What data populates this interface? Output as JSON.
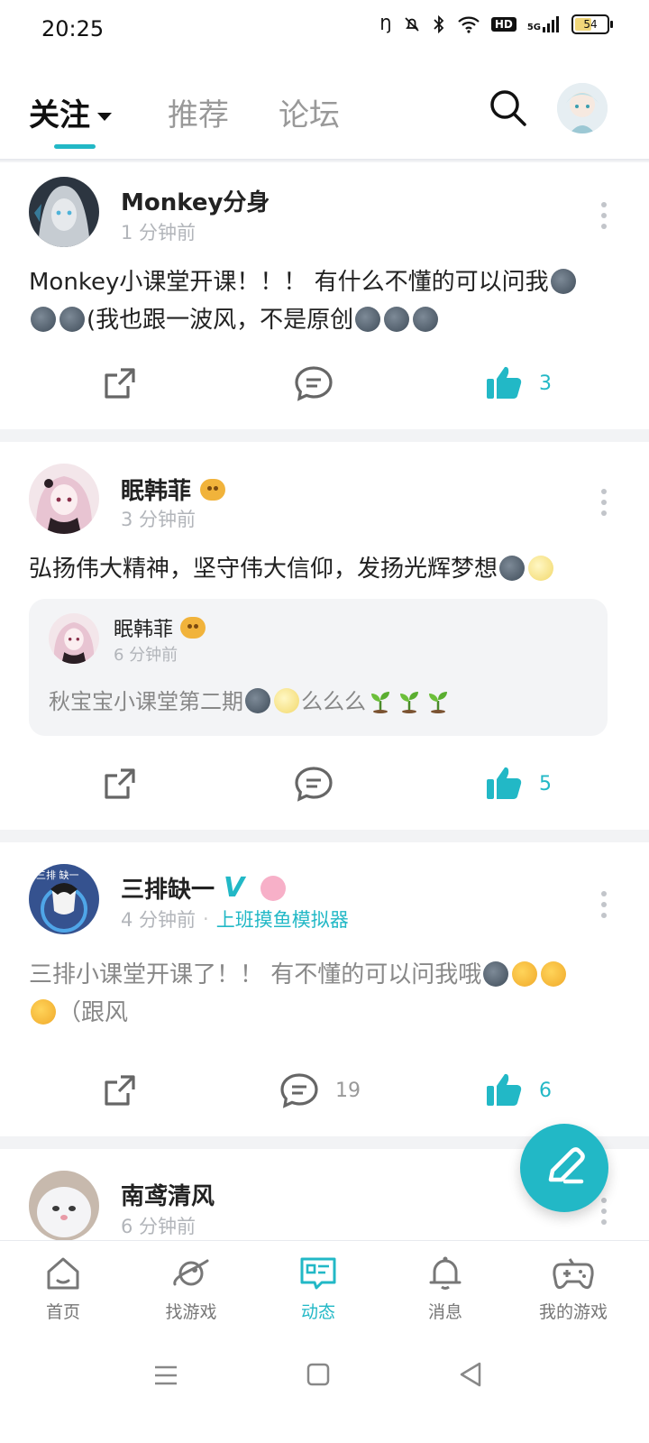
{
  "status_bar": {
    "time": "20:25",
    "network": "5G",
    "battery": "54",
    "battery_level": 0.54
  },
  "top_nav": {
    "tabs": [
      {
        "label": "关注"
      },
      {
        "label": "推荐"
      },
      {
        "label": "论坛"
      }
    ]
  },
  "posts": [
    {
      "user": "Monkey分身",
      "time": "1 分钟前",
      "text": "Monkey小课堂开课！！！ 有什么不懂的可以问我",
      "text2": "(我也跟一波风，不是原创",
      "likes": "3"
    },
    {
      "user": "眠韩菲",
      "time": "3 分钟前",
      "text": "弘扬伟大精神，坚守伟大信仰，发扬光辉梦想",
      "quote": {
        "user": "眠韩菲",
        "time": "6 分钟前",
        "text": "秋宝宝小课堂第二期",
        "text2": "么么么"
      },
      "likes": "5"
    },
    {
      "user": "三排缺一",
      "verified": "V",
      "time": "4 分钟前",
      "game": "上班摸鱼模拟器",
      "text": "三排小课堂开课了！！ 有不懂的可以问我哦",
      "text2": "（跟风",
      "comments": "19",
      "likes": "6"
    },
    {
      "user": "南鸢清风",
      "time": "6 分钟前"
    }
  ],
  "bottom_nav": [
    {
      "label": "首页",
      "icon": "home-icon"
    },
    {
      "label": "找游戏",
      "icon": "planet-icon"
    },
    {
      "label": "动态",
      "icon": "feed-icon"
    },
    {
      "label": "消息",
      "icon": "bell-icon"
    },
    {
      "label": "我的游戏",
      "icon": "gamepad-icon"
    }
  ],
  "colors": {
    "accent": "#22b8c6",
    "muted": "#b2b5ba"
  }
}
